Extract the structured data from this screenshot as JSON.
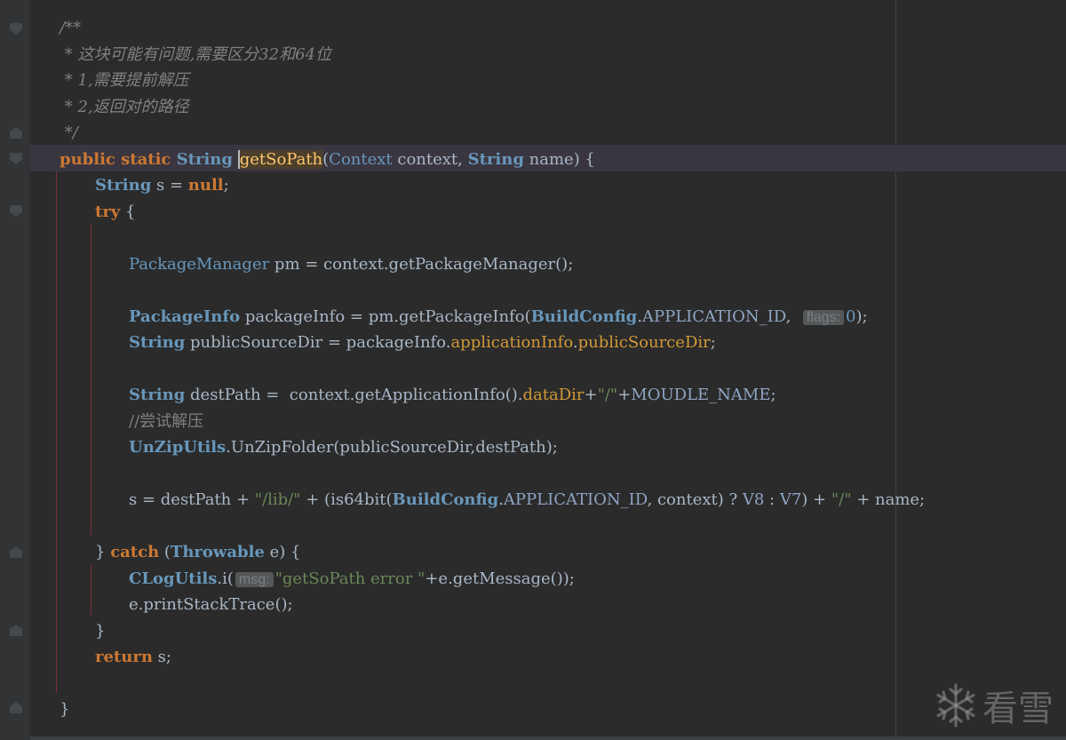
{
  "editor": {
    "lines": [
      [
        {
          "t": "/**",
          "c": "cmi"
        }
      ],
      [
        {
          "t": " * 这块可能有问题,需要区分32和64位",
          "c": "cmi"
        }
      ],
      [
        {
          "t": " * 1,需要提前解压",
          "c": "cmi"
        }
      ],
      [
        {
          "t": " * 2,返回对的路径",
          "c": "cmi"
        }
      ],
      [
        {
          "t": " */",
          "c": "cmi"
        }
      ],
      [
        {
          "t": "public static ",
          "c": "kw"
        },
        {
          "t": "String",
          "c": "ty"
        },
        {
          "t": " ",
          "c": "id"
        },
        {
          "t": "getSoPath",
          "c": "fn-hl"
        },
        {
          "t": "(",
          "c": "id"
        },
        {
          "t": "Context",
          "c": "ty-plain"
        },
        {
          "t": " context, ",
          "c": "id"
        },
        {
          "t": "String",
          "c": "ty"
        },
        {
          "t": " name) {",
          "c": "id"
        }
      ],
      [
        {
          "t": "String",
          "c": "ty"
        },
        {
          "t": " s = ",
          "c": "id"
        },
        {
          "t": "null",
          "c": "kw"
        },
        {
          "t": ";",
          "c": "id"
        }
      ],
      [
        {
          "t": "try",
          "c": "kw"
        },
        {
          "t": " {",
          "c": "id"
        }
      ],
      [],
      [
        {
          "t": "PackageManager",
          "c": "ty-plain"
        },
        {
          "t": " pm = context.getPackageManager();",
          "c": "id"
        }
      ],
      [],
      [
        {
          "t": "PackageInfo",
          "c": "ty"
        },
        {
          "t": " packageInfo = pm.getPackageInfo(",
          "c": "id"
        },
        {
          "t": "BuildConfig",
          "c": "ty"
        },
        {
          "t": ".",
          "c": "id"
        },
        {
          "t": "APPLICATION_ID",
          "c": "const"
        },
        {
          "t": ",  ",
          "c": "id"
        },
        {
          "t": "flags:",
          "c": "hint"
        },
        {
          "t": "0",
          "c": "num"
        },
        {
          "t": ");",
          "c": "id"
        }
      ],
      [
        {
          "t": "String",
          "c": "ty"
        },
        {
          "t": " publicSourceDir = packageInfo.",
          "c": "id"
        },
        {
          "t": "applicationInfo",
          "c": "fld"
        },
        {
          "t": ".",
          "c": "id"
        },
        {
          "t": "publicSourceDir",
          "c": "fld"
        },
        {
          "t": ";",
          "c": "id"
        }
      ],
      [],
      [
        {
          "t": "String",
          "c": "ty"
        },
        {
          "t": " destPath =  context.getApplicationInfo().",
          "c": "id"
        },
        {
          "t": "dataDir",
          "c": "fld"
        },
        {
          "t": "+",
          "c": "id"
        },
        {
          "t": "\"/\"",
          "c": "str"
        },
        {
          "t": "+",
          "c": "id"
        },
        {
          "t": "MOUDLE_NAME",
          "c": "const"
        },
        {
          "t": ";",
          "c": "id"
        }
      ],
      [
        {
          "t": "//尝试解压",
          "c": "cm"
        }
      ],
      [
        {
          "t": "UnZipUtils",
          "c": "ty"
        },
        {
          "t": ".UnZipFolder(publicSourceDir,destPath);",
          "c": "id"
        }
      ],
      [],
      [
        {
          "t": "s = destPath + ",
          "c": "id"
        },
        {
          "t": "\"/lib/\"",
          "c": "str"
        },
        {
          "t": " + (is64bit(",
          "c": "id"
        },
        {
          "t": "BuildConfig",
          "c": "ty"
        },
        {
          "t": ".",
          "c": "id"
        },
        {
          "t": "APPLICATION_ID",
          "c": "const"
        },
        {
          "t": ", context) ? ",
          "c": "id"
        },
        {
          "t": "V8",
          "c": "const"
        },
        {
          "t": " : ",
          "c": "id"
        },
        {
          "t": "V7",
          "c": "const"
        },
        {
          "t": ") + ",
          "c": "id"
        },
        {
          "t": "\"/\"",
          "c": "str"
        },
        {
          "t": " + name;",
          "c": "id"
        }
      ],
      [],
      [
        {
          "t": "} ",
          "c": "id"
        },
        {
          "t": "catch",
          "c": "kw"
        },
        {
          "t": " (",
          "c": "id"
        },
        {
          "t": "Throwable",
          "c": "ty"
        },
        {
          "t": " e) {",
          "c": "id"
        }
      ],
      [
        {
          "t": "CLogUtils",
          "c": "ty"
        },
        {
          "t": ".i(",
          "c": "id"
        },
        {
          "t": "msg:",
          "c": "hint"
        },
        {
          "t": "\"getSoPath error \"",
          "c": "str"
        },
        {
          "t": "+e.getMessage());",
          "c": "id"
        }
      ],
      [
        {
          "t": "e.printStackTrace();",
          "c": "id"
        }
      ],
      [
        {
          "t": "}",
          "c": "id"
        }
      ],
      [
        {
          "t": "return",
          "c": "kw"
        },
        {
          "t": " s;",
          "c": "id"
        }
      ],
      [],
      [
        {
          "t": "}",
          "c": "id"
        }
      ]
    ]
  },
  "watermark": {
    "icon": "snowflake-icon",
    "text": "看雪"
  },
  "colors": {
    "background": "#2b2b2b",
    "keyword": "#cc7832",
    "type": "#6897bb",
    "string": "#6a8759",
    "comment": "#808080",
    "field": "#d19a36",
    "method_highlight": "#ffc66d"
  }
}
